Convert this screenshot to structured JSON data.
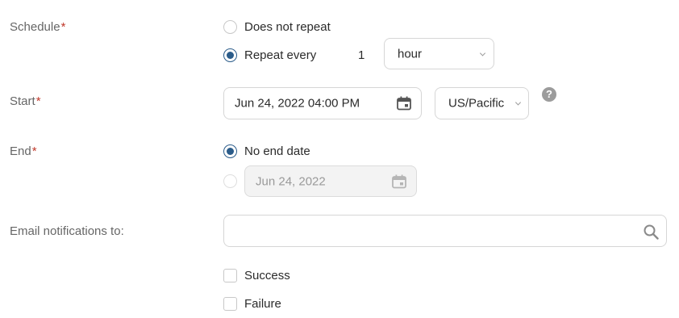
{
  "schedule": {
    "label": "Schedule",
    "required_mark": "*",
    "options": {
      "does_not_repeat": "Does not repeat",
      "repeat_every": "Repeat every"
    },
    "selected": "repeat_every",
    "interval_value": "1",
    "interval_unit": "hour"
  },
  "start": {
    "label": "Start",
    "required_mark": "*",
    "datetime": "Jun 24, 2022 04:00 PM",
    "timezone": "US/Pacific",
    "help_glyph": "?"
  },
  "end": {
    "label": "End",
    "required_mark": "*",
    "options": {
      "no_end_date": "No end date"
    },
    "selected": "no_end_date",
    "end_date": "Jun 24, 2022"
  },
  "email": {
    "label": "Email notifications to:",
    "value": "",
    "checkboxes": {
      "success": "Success",
      "failure": "Failure"
    }
  },
  "colors": {
    "accent": "#2b5c8a",
    "required": "#c0392b",
    "label": "#666666"
  },
  "icons": [
    "calendar-icon",
    "chevron-down-icon",
    "help-icon",
    "search-icon"
  ]
}
